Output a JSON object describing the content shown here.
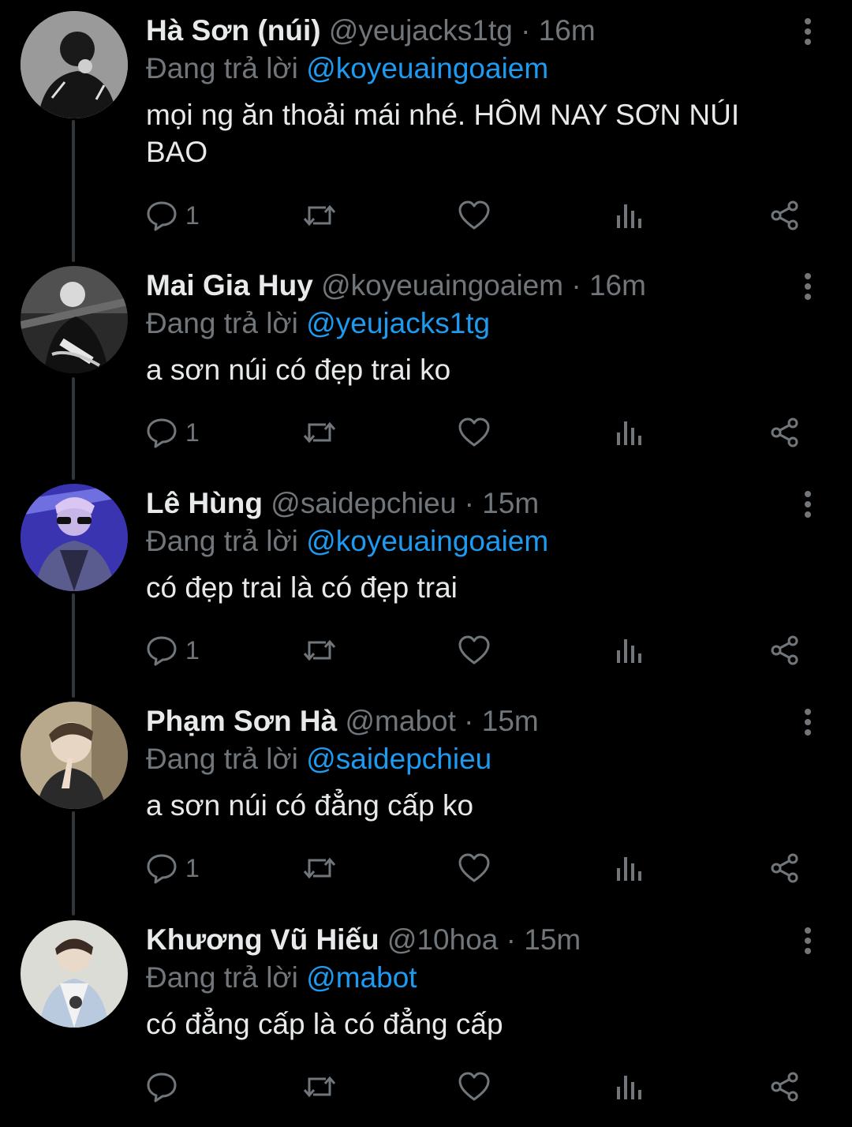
{
  "thread": {
    "reply_prefix": "Đang trả lời",
    "dot": "·",
    "tweets": [
      {
        "display_name": "Hà Sơn (núi)",
        "handle": "@yeujacks1tg",
        "time": "16m",
        "reply_to": "@koyeuaingoaiem",
        "text": "mọi ng ăn thoải mái nhé. HÔM NAY SƠN NÚI BAO",
        "reply_count": "1"
      },
      {
        "display_name": "Mai Gia Huy",
        "handle": "@koyeuaingoaiem",
        "time": "16m",
        "reply_to": "@yeujacks1tg",
        "text": "a sơn núi có đẹp trai ko",
        "reply_count": "1"
      },
      {
        "display_name": "Lê Hùng",
        "handle": "@saidepchieu",
        "time": "15m",
        "reply_to": "@koyeuaingoaiem",
        "text": "có đẹp trai là có đẹp trai",
        "reply_count": "1"
      },
      {
        "display_name": "Phạm Sơn Hà",
        "handle": "@mabot",
        "time": "15m",
        "reply_to": "@saidepchieu",
        "text": "a sơn núi có đẳng cấp ko",
        "reply_count": "1"
      },
      {
        "display_name": "Khương Vũ Hiếu",
        "handle": "@10hoa",
        "time": "15m",
        "reply_to": "@mabot",
        "text": "có đẳng cấp là có đẳng cấp",
        "reply_count": ""
      }
    ]
  },
  "icons": {
    "reply": "speech-bubble-icon",
    "retweet": "retweet-icon",
    "like": "heart-icon",
    "views": "bar-chart-icon",
    "share": "share-icon",
    "more": "vertical-dots-icon"
  },
  "colors": {
    "background": "#000000",
    "text": "#e7e9ea",
    "muted": "#71767b",
    "accent": "#1d9bf0",
    "thread_line": "#333639"
  }
}
